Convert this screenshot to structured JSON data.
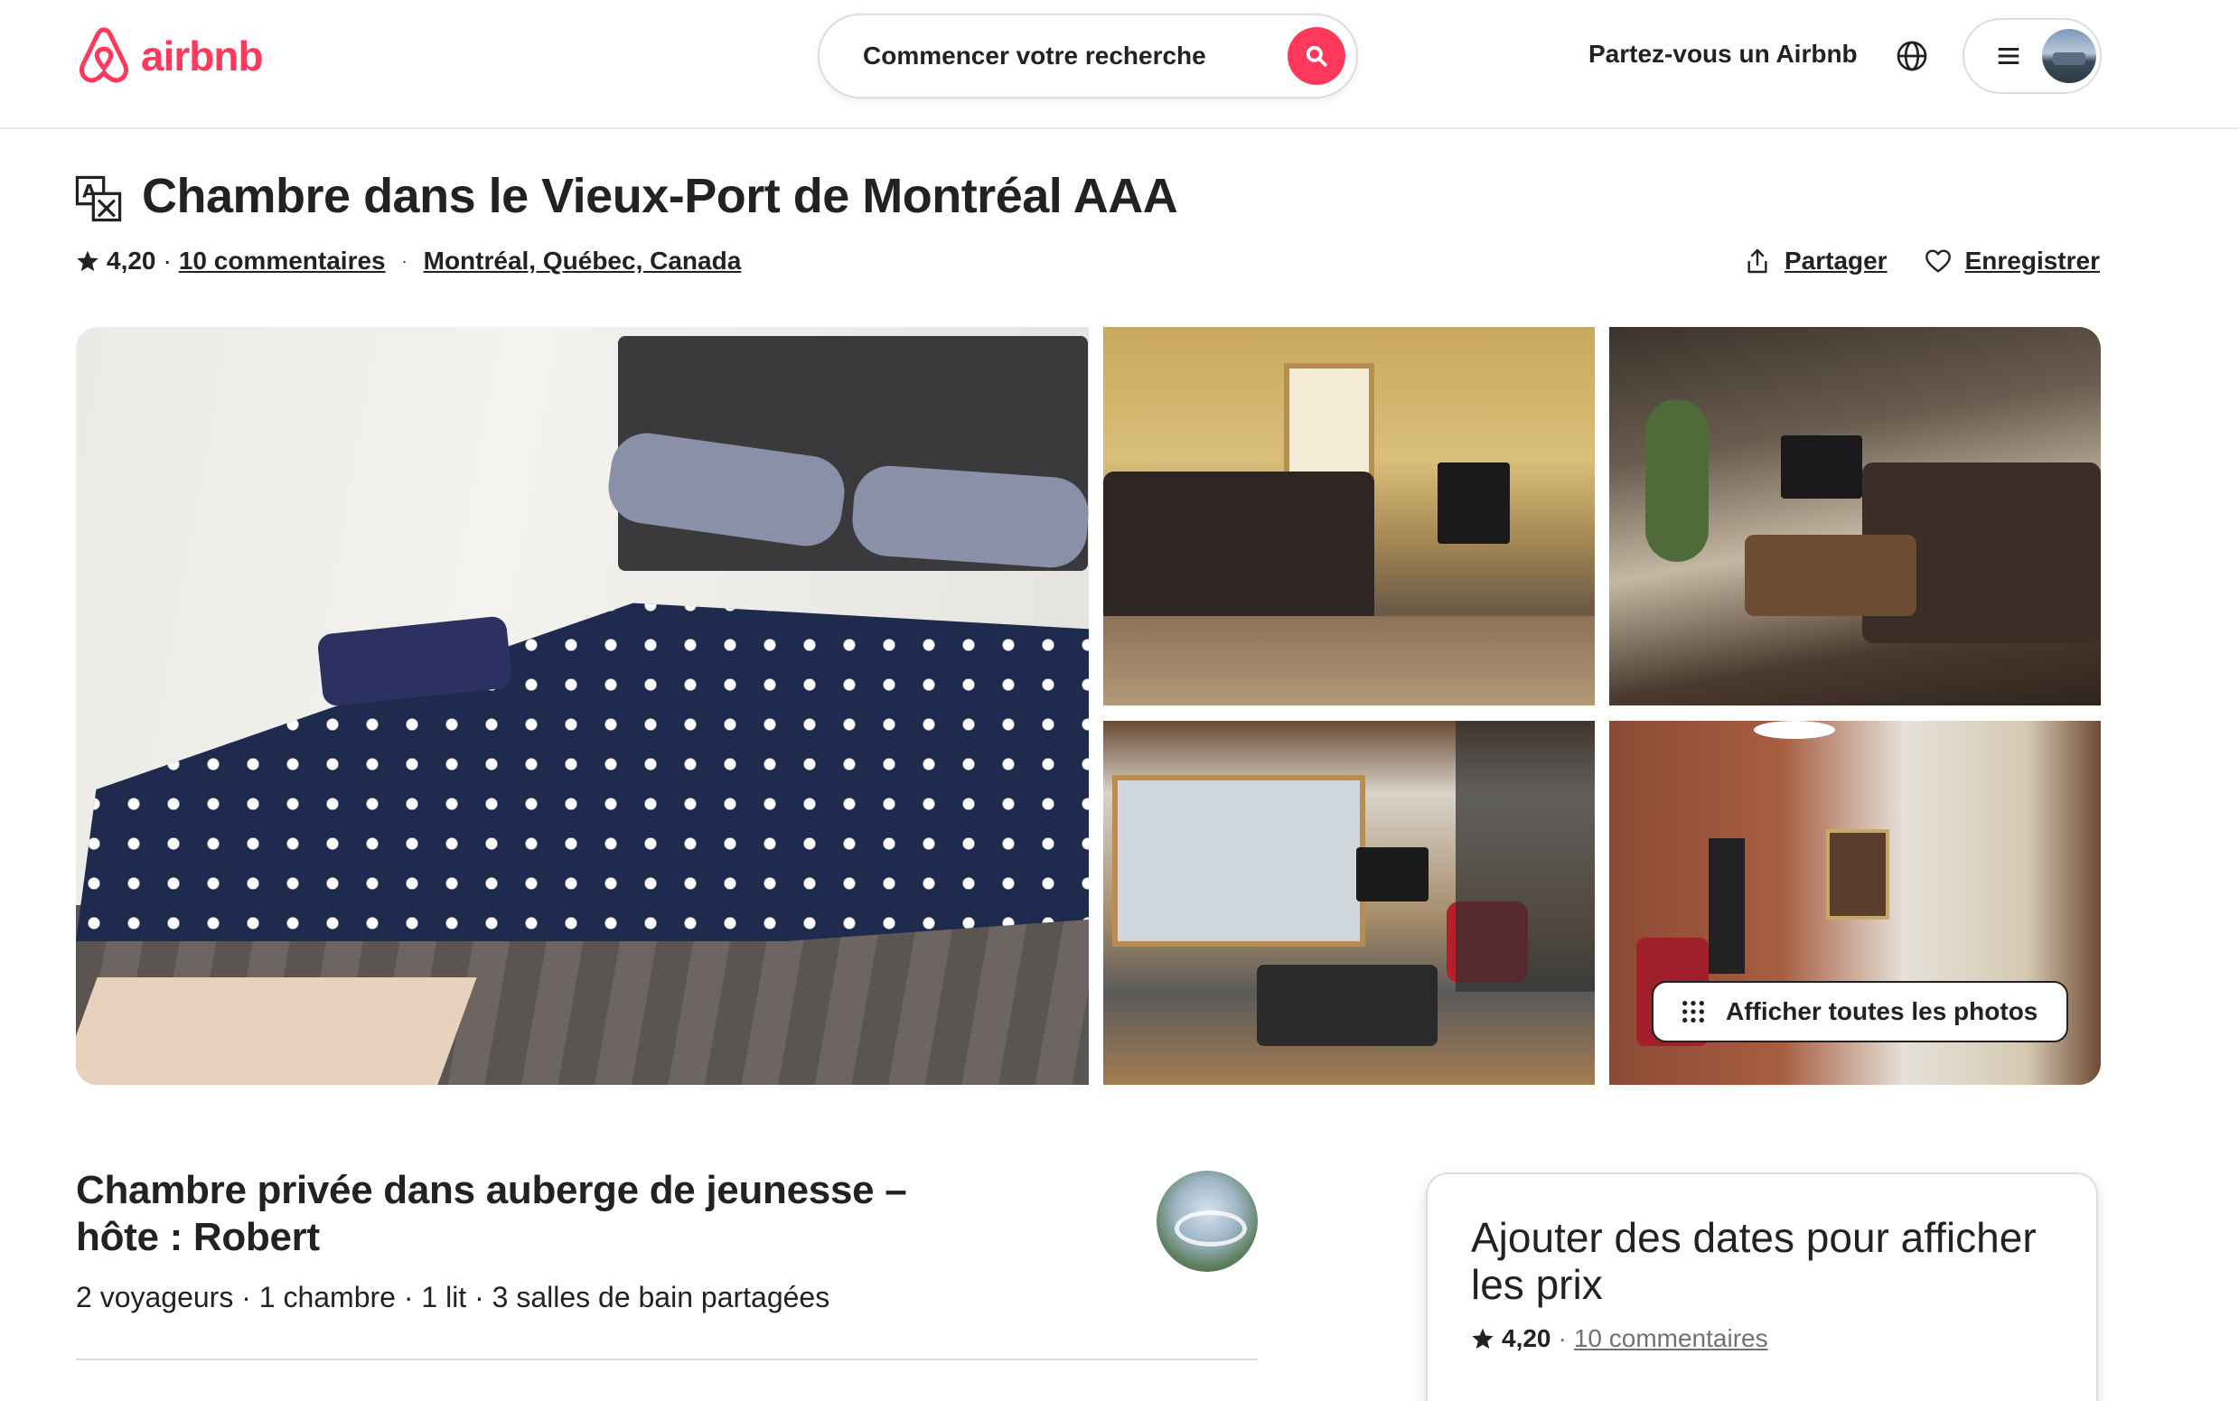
{
  "brand": {
    "name": "airbnb",
    "color": "#FF385C"
  },
  "header": {
    "search_placeholder": "Commencer votre recherche",
    "host_link": "Partez-vous un Airbnb",
    "icons": [
      "airbnb-logo-icon",
      "search-icon",
      "globe-icon",
      "menu-icon",
      "avatar"
    ]
  },
  "listing": {
    "title": "Chambre dans le Vieux-Port de Montréal AAA",
    "rating": "4,20",
    "rating_sep": "·",
    "reviews_link": "10 commentaires",
    "location_sep": "·",
    "location": "Montréal, Québec, Canada",
    "share_label": "Partager",
    "save_label": "Enregistrer"
  },
  "gallery": {
    "show_all_label": "Afficher toutes les photos"
  },
  "summary": {
    "heading": "Chambre privée dans auberge de jeunesse – hôte : Robert",
    "details": "2 voyageurs · 1 chambre · 1 lit · 3 salles de bain partagées"
  },
  "booking": {
    "title": "Ajouter des dates pour afficher les prix",
    "rating": "4,20",
    "rating_sep": "·",
    "reviews_link": "10 commentaires"
  }
}
